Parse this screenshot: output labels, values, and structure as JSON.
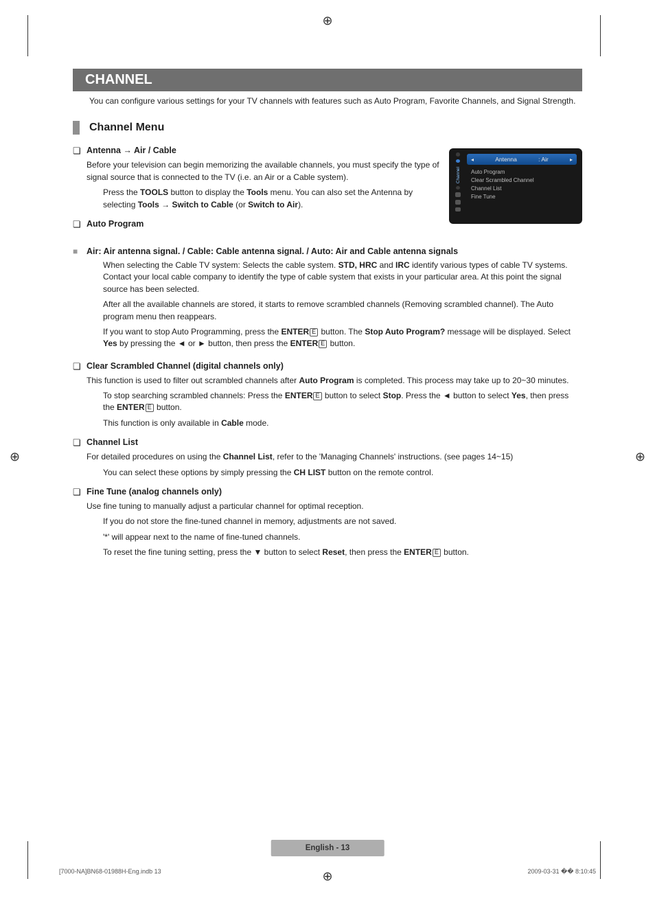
{
  "section": {
    "title": "CHANNEL",
    "intro": "You can configure various settings for your TV channels with features such as Auto Program, Favorite Channels, and Signal Strength."
  },
  "channel_menu": {
    "title": "Channel Menu"
  },
  "antenna": {
    "heading": "Antenna → Air / Cable",
    "body": "Before your television can begin memorizing the available channels, you must specify the type of signal source that is connected to the TV (i.e. an Air or a Cable system).",
    "note_prefix": "Press the ",
    "note_bold1": "TOOLS",
    "note_mid1": " button to display the ",
    "note_bold2": "Tools",
    "note_mid2": " menu. You can also set the Antenna by selecting ",
    "note_bold3": "Tools → Switch to Cable",
    "note_mid3": " (or ",
    "note_bold4": "Switch to Air",
    "note_end": ")."
  },
  "auto_program": {
    "heading": "Auto Program",
    "sub_heading": "Air: Air antenna signal. / Cable: Cable antenna signal. / Auto: Air and Cable antenna signals",
    "n1_pre": "When selecting the Cable TV system: Selects the cable system. ",
    "n1_b1": "STD, HRC",
    "n1_mid1": " and ",
    "n1_b2": "IRC",
    "n1_post": " identify various types of cable TV systems. Contact your local cable company to identify the type of cable system that exists in your particular area. At this point the signal source has been selected.",
    "n2": "After all the available channels are stored, it starts to remove scrambled channels (Removing scrambled channel). The Auto program menu then reappears.",
    "n3_pre": "If you want to stop Auto Programming, press the ",
    "n3_b1": "ENTER",
    "n3_mid1": " button. The ",
    "n3_b2": "Stop Auto Program?",
    "n3_mid2": " message will be displayed. Select ",
    "n3_b3": "Yes",
    "n3_mid3": " by pressing the ◄ or ► button, then press the ",
    "n3_b4": "ENTER",
    "n3_post": " button."
  },
  "csc": {
    "heading": "Clear Scrambled Channel (digital channels only)",
    "body_pre": "This function is used to filter out scrambled channels after ",
    "body_b1": "Auto Program",
    "body_post": " is completed. This process may take up to 20~30 minutes.",
    "n1_pre": "To stop searching scrambled channels: Press the ",
    "n1_b1": "ENTER",
    "n1_mid1": " button to select ",
    "n1_b2": "Stop",
    "n1_mid2": ". Press the ◄ button to select ",
    "n1_b3": "Yes",
    "n1_mid3": ", then press the ",
    "n1_b4": "ENTER",
    "n1_post": " button.",
    "n2_pre": "This function is only available in ",
    "n2_b1": "Cable",
    "n2_post": " mode."
  },
  "channel_list": {
    "heading": "Channel List",
    "body_pre": "For detailed procedures on using the ",
    "body_b1": "Channel List",
    "body_post": ", refer to the 'Managing Channels' instructions. (see pages 14~15)",
    "note_pre": "You can select these options by simply pressing the ",
    "note_b1": "CH LIST",
    "note_post": " button on the remote control."
  },
  "fine_tune": {
    "heading": "Fine Tune (analog channels only)",
    "body": "Use fine tuning to manually adjust a particular channel for optimal reception.",
    "n1": "If you do not store the fine-tuned channel in memory, adjustments are not saved.",
    "n2": "'*' will appear next to the name of fine-tuned channels.",
    "n3_pre": "To reset the fine tuning setting, press the ▼ button to select ",
    "n3_b1": "Reset",
    "n3_mid": ", then press the ",
    "n3_b2": "ENTER",
    "n3_post": " button."
  },
  "osd": {
    "side_label": "Channel",
    "sel_label": "Antenna",
    "sel_value": ": Air",
    "items": [
      "Auto Program",
      "Clear Scrambled Channel",
      "Channel List",
      "Fine Tune"
    ]
  },
  "footer": {
    "page_label": "English - 13",
    "doc": "[7000-NA]BN68-01988H-Eng.indb   13",
    "time": "2009-03-31   �� 8:10:45"
  },
  "icons": {
    "q": "❏",
    "note": "",
    "tool": "",
    "remote": "",
    "square": "■",
    "enter": "E"
  }
}
